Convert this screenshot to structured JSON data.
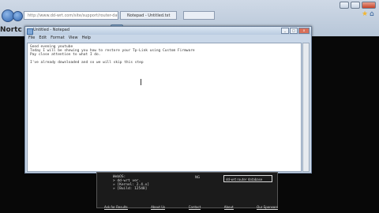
{
  "browser": {
    "address_value": "http://www.dd-wrt.com/site/support/router-database",
    "tab_active": "Notepad - Untitled.txt",
    "tab_other": "",
    "toolbar_label": "Nortc"
  },
  "notepad": {
    "title": "Untitled - Notepad",
    "menu": [
      "File",
      "Edit",
      "Format",
      "View",
      "Help"
    ],
    "content": "Good evening youtube\nToday I will be showing you how to restore your Tp-Link using Custom Firmware\nPay close attention to what I do.\n\nI've already downloaded and so we will skip this step"
  },
  "router_panel": {
    "list": [
      "WebOS:",
      "> dd-wrt ver.",
      "» [Kernel: 2.4.x]",
      "» [Build: 12548]"
    ],
    "center_label": "NG",
    "box_text": "dd-wrt router database"
  },
  "bottom_links": [
    "Ask for Results",
    "About Us",
    "Contact",
    "About",
    "Our Sponsors"
  ],
  "colors": {
    "titlebar": "#c9d7e8",
    "page_bg": "#080808"
  }
}
